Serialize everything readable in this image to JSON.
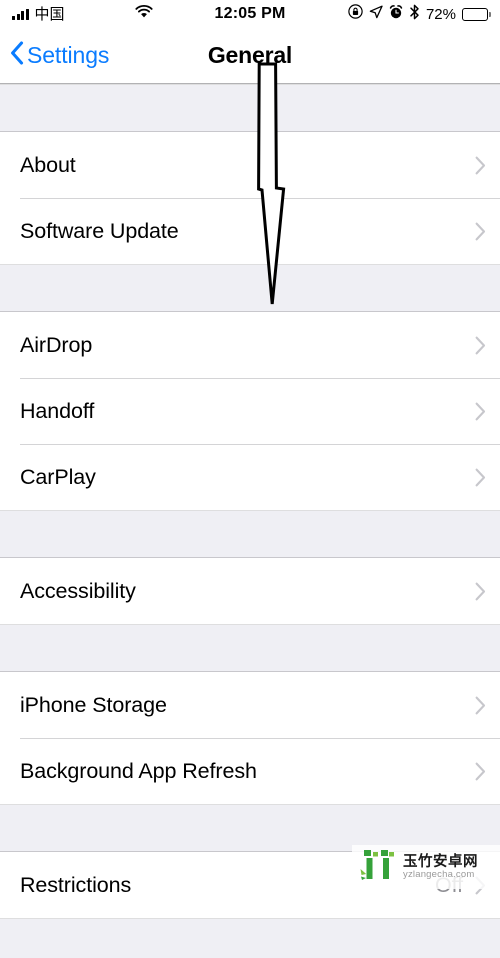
{
  "status_bar": {
    "signal_icon": "signal-bars-icon",
    "carrier": "中国",
    "wifi_icon": "wifi-icon",
    "time": "12:05 PM",
    "rotation_lock_icon": "rotation-lock-icon",
    "location_icon": "location-arrow-icon",
    "alarm_icon": "alarm-clock-icon",
    "bluetooth_icon": "bluetooth-icon",
    "battery_percent": "72%",
    "battery_icon": "battery-icon"
  },
  "nav": {
    "back_label": "Settings",
    "back_icon": "chevron-left-icon",
    "title": "General"
  },
  "groups": [
    {
      "rows": [
        {
          "label": "About",
          "value": "",
          "accessory": "chevron-right-icon"
        },
        {
          "label": "Software Update",
          "value": "",
          "accessory": "chevron-right-icon"
        }
      ]
    },
    {
      "rows": [
        {
          "label": "AirDrop",
          "value": "",
          "accessory": "chevron-right-icon"
        },
        {
          "label": "Handoff",
          "value": "",
          "accessory": "chevron-right-icon"
        },
        {
          "label": "CarPlay",
          "value": "",
          "accessory": "chevron-right-icon"
        }
      ]
    },
    {
      "rows": [
        {
          "label": "Accessibility",
          "value": "",
          "accessory": "chevron-right-icon"
        }
      ]
    },
    {
      "rows": [
        {
          "label": "iPhone Storage",
          "value": "",
          "accessory": "chevron-right-icon"
        },
        {
          "label": "Background App Refresh",
          "value": "",
          "accessory": "chevron-right-icon"
        }
      ]
    },
    {
      "rows": [
        {
          "label": "Restrictions",
          "value": "Off",
          "accessory": "chevron-right-icon"
        }
      ]
    }
  ],
  "annotation": {
    "type": "down-arrow-pointer",
    "description": "hollow black-outlined downward arrow pointing from title area to AirDrop section"
  },
  "watermark": {
    "site_name": "玉竹安卓网",
    "url": "yzlangecha.com",
    "logo_color": "#35a23a"
  },
  "colors": {
    "accent": "#0a7cff",
    "background": "#efeff4",
    "row_background": "#ffffff",
    "separator": "#d4d4d6",
    "secondary_text": "#8e8e93",
    "chevron": "#c7c7cc"
  }
}
